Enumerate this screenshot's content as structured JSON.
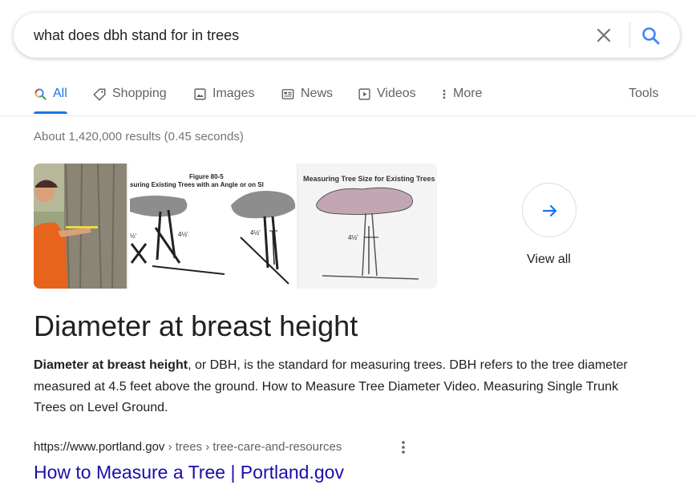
{
  "search": {
    "query": "what does dbh stand for in trees"
  },
  "tabs": [
    {
      "label": "All",
      "icon": "search-icon",
      "active": true
    },
    {
      "label": "Shopping",
      "icon": "tag-icon"
    },
    {
      "label": "Images",
      "icon": "image-icon"
    },
    {
      "label": "News",
      "icon": "news-icon"
    },
    {
      "label": "Videos",
      "icon": "play-icon"
    },
    {
      "label": "More",
      "icon": "more-vert-icon"
    }
  ],
  "tools_label": "Tools",
  "stats": "About 1,420,000 results (0.45 seconds)",
  "images": {
    "figure2_title": "Figure 80-5",
    "figure2_subtitle": "suring Existing Trees with an Angle or on Sl",
    "figure2_label_a": "4½'",
    "figure2_label_b": "4½'",
    "figure2_label_c": "½'",
    "figure3_title": "Measuring Tree Size for Existing Trees",
    "figure3_label": "4½'",
    "view_all": "View all"
  },
  "answer": {
    "title": "Diameter at breast height",
    "snippet_bold": "Diameter at breast height",
    "snippet_rest": ", or DBH, is the standard for measuring trees. DBH refers to the tree diameter measured at 4.5 feet above the ground. How to Measure Tree Diameter Video. Measuring Single Trunk Trees on Level Ground."
  },
  "result": {
    "cite_domain": "https://www.portland.gov",
    "cite_path": " › trees › tree-care-and-resources",
    "title": "How to Measure a Tree | Portland.gov"
  },
  "colors": {
    "accent": "#1a73e8",
    "link": "#1a0dab",
    "muted": "#70757a"
  }
}
